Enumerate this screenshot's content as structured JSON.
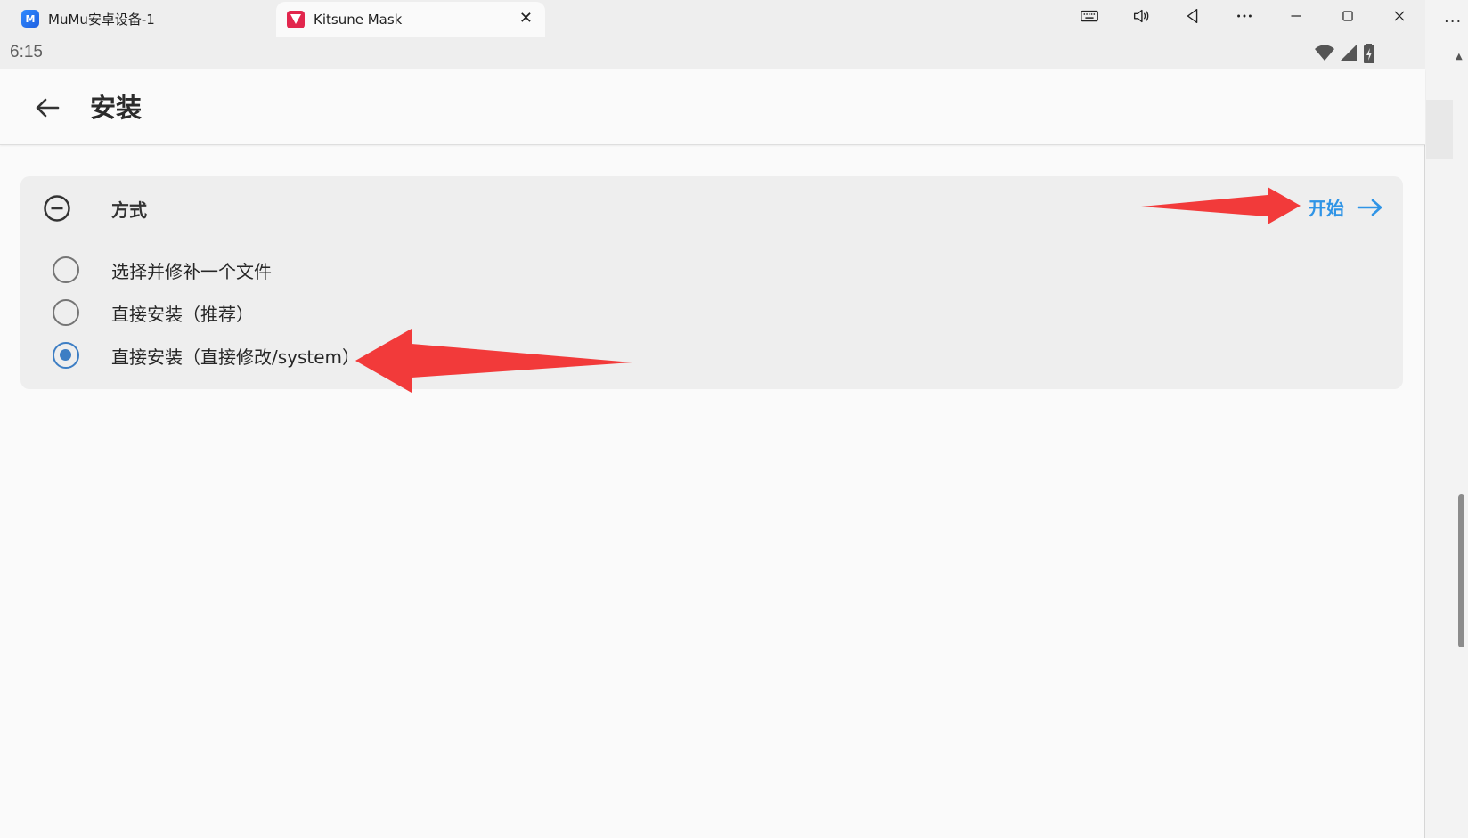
{
  "tabs": [
    {
      "label": "MuMu安卓设备-1",
      "icon": "mumu-app-icon",
      "active": false
    },
    {
      "label": "Kitsune Mask",
      "icon": "fox-mask-icon",
      "active": true
    }
  ],
  "tab_close": "✕",
  "window_controls": [
    "keyboard-icon",
    "volume-icon",
    "back-nav-icon",
    "more-icon",
    "minimize-icon",
    "maximize-icon",
    "close-icon"
  ],
  "status_bar": {
    "time": "6:15"
  },
  "appbar": {
    "title": "安装"
  },
  "method_card": {
    "title": "方式",
    "start_label": "开始",
    "options": [
      {
        "label": "选择并修补一个文件",
        "checked": false
      },
      {
        "label": "直接安装（推荐）",
        "checked": false
      },
      {
        "label": "直接安装（直接修改/system）",
        "checked": true
      }
    ]
  },
  "colors": {
    "accent": "#2f94e6",
    "radio_checked": "#3d7ec4",
    "annotation_arrow": "#f23a3a"
  },
  "side_panel": {
    "menu": "···"
  }
}
